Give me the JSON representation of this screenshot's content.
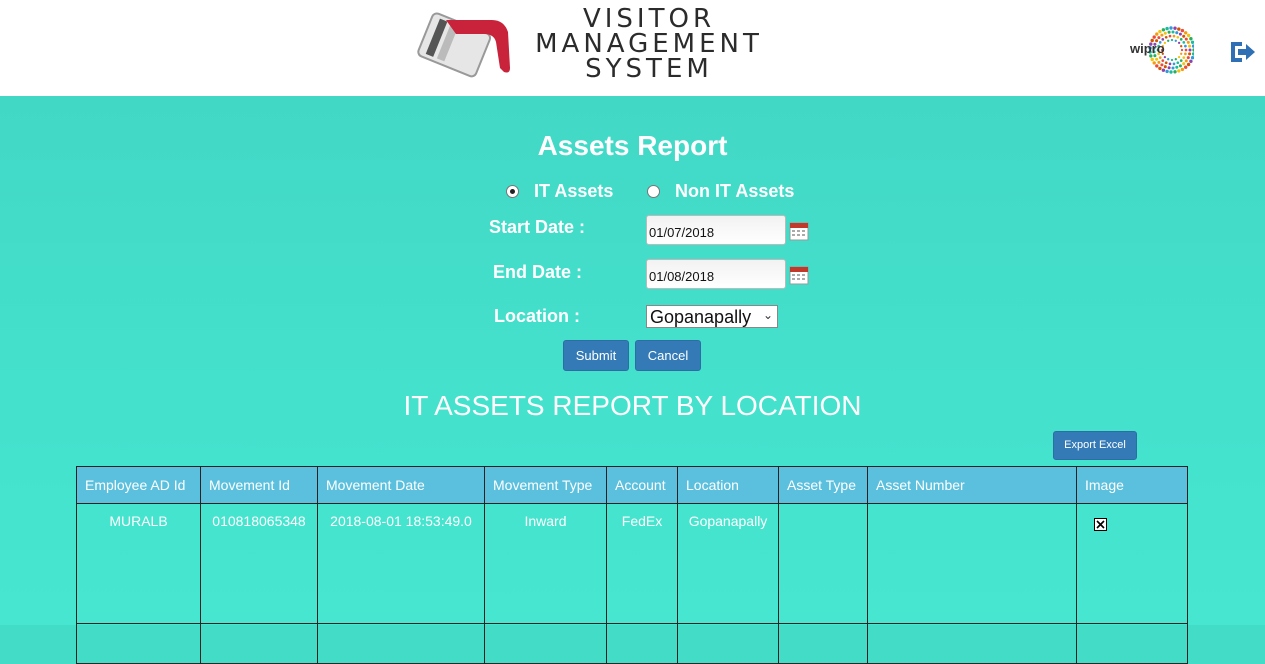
{
  "header": {
    "logo_lines": [
      "VISITOR",
      "MANAGEMENT",
      "SYSTEM"
    ],
    "brand": "wipro",
    "logout_icon": "sign-out-icon"
  },
  "form": {
    "title": "Assets Report",
    "radio_it": "IT Assets",
    "radio_non_it": "Non IT Assets",
    "selected": "IT Assets",
    "start_label": "Start Date :",
    "start_value": "01/07/2018",
    "end_label": "End Date :",
    "end_value": "01/08/2018",
    "location_label": "Location :",
    "location_value": "Gopanapally",
    "submit": "Submit",
    "cancel": "Cancel"
  },
  "report": {
    "title": "IT ASSETS REPORT BY LOCATION",
    "export": "Export Excel",
    "columns": [
      "Employee AD Id",
      "Movement Id",
      "Movement Date",
      "Movement Type",
      "Account",
      "Location",
      "Asset Type",
      "Asset Number",
      "Image"
    ],
    "rows": [
      [
        "MURALB",
        "010818065348",
        "2018-08-01 18:53:49.0",
        "Inward",
        "FedEx",
        "Gopanapally",
        "",
        "",
        ""
      ]
    ]
  },
  "colors": {
    "background": "#43dcc6",
    "button": "#337ab7",
    "table_header": "#5bc0de",
    "logo_red": "#c8233b"
  }
}
